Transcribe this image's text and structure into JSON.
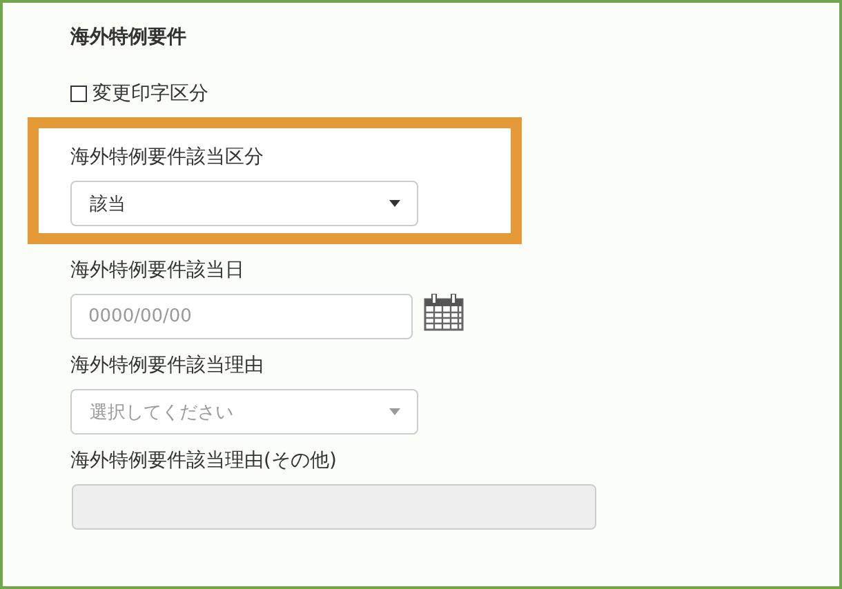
{
  "section_title": "海外特例要件",
  "checkbox": {
    "label": "変更印字区分",
    "checked": false
  },
  "fields": [
    {
      "kind": "select",
      "label": "海外特例要件該当区分",
      "value": "該当",
      "highlighted": true
    },
    {
      "kind": "date",
      "label": "海外特例要件該当日",
      "placeholder": "0000/00/00",
      "highlighted": false
    },
    {
      "kind": "select",
      "label": "海外特例要件該当理由",
      "placeholder": "選択してください",
      "disabled": true,
      "highlighted": false
    },
    {
      "kind": "text",
      "label": "海外特例要件該当理由(その他)",
      "disabled": true,
      "highlighted": false
    }
  ]
}
